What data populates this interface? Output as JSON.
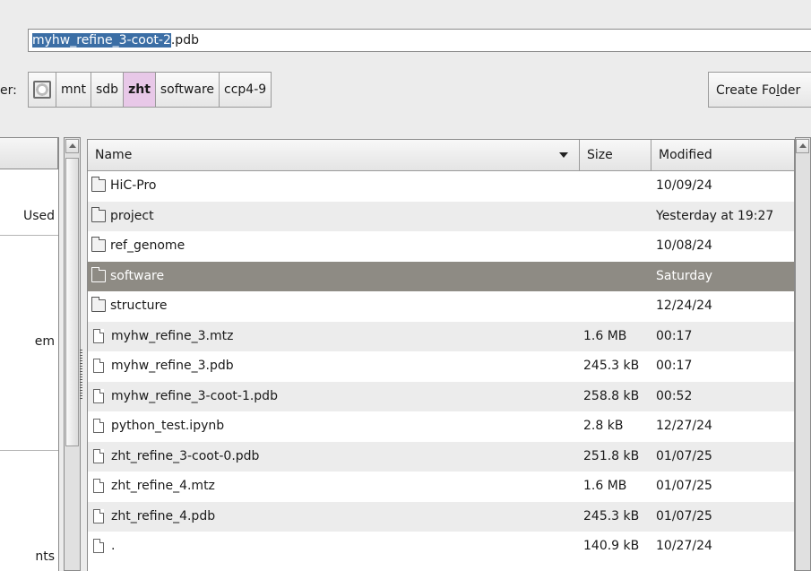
{
  "filename": {
    "selected": "myhw_refine_3-coot-2",
    "rest": ".pdb"
  },
  "folder_label": "er:",
  "pathbar": [
    "mnt",
    "sdb",
    "zht",
    "software",
    "ccp4-9"
  ],
  "create_folder": {
    "before": "Create Fo",
    "mnemonic": "l",
    "after": "der"
  },
  "places": {
    "recent": "Used",
    "filesystem": "em",
    "documents": "nts"
  },
  "columns": {
    "name": "Name",
    "size": "Size",
    "modified": "Modified"
  },
  "files": [
    {
      "type": "folder",
      "name": "HiC-Pro",
      "size": "",
      "modified": "10/09/24"
    },
    {
      "type": "folder",
      "name": "project",
      "size": "",
      "modified": "Yesterday at 19:27"
    },
    {
      "type": "folder",
      "name": "ref_genome",
      "size": "",
      "modified": "10/08/24"
    },
    {
      "type": "folder",
      "name": "software",
      "size": "",
      "modified": "Saturday",
      "selected": true
    },
    {
      "type": "folder",
      "name": "structure",
      "size": "",
      "modified": "12/24/24"
    },
    {
      "type": "file",
      "name": "myhw_refine_3.mtz",
      "size": "1.6 MB",
      "modified": "00:17"
    },
    {
      "type": "file",
      "name": "myhw_refine_3.pdb",
      "size": "245.3 kB",
      "modified": "00:17"
    },
    {
      "type": "file",
      "name": "myhw_refine_3-coot-1.pdb",
      "size": "258.8 kB",
      "modified": "00:52"
    },
    {
      "type": "file",
      "name": "python_test.ipynb",
      "size": "2.8 kB",
      "modified": "12/27/24"
    },
    {
      "type": "file",
      "name": "zht_refine_3-coot-0.pdb",
      "size": "251.8 kB",
      "modified": "01/07/25"
    },
    {
      "type": "file",
      "name": "zht_refine_4.mtz",
      "size": "1.6 MB",
      "modified": "01/07/25"
    },
    {
      "type": "file",
      "name": "zht_refine_4.pdb",
      "size": "245.3 kB",
      "modified": "01/07/25"
    },
    {
      "type": "file",
      "name": ".",
      "size": "140.9 kB",
      "modified": "10/27/24"
    }
  ]
}
